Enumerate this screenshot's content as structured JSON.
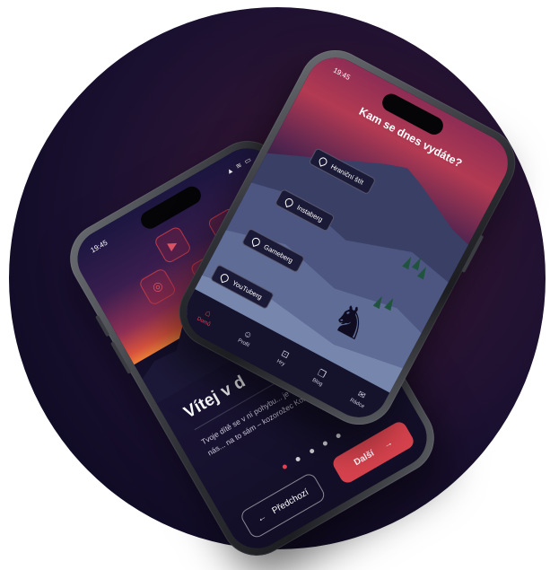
{
  "phone_left": {
    "status_time": "19:45",
    "status_icons": "▲ ≋ ▭",
    "app_icons": [
      {
        "name": "video-player-icon",
        "glyph": "▶"
      },
      {
        "name": "gamepad-icon",
        "glyph": "◆"
      },
      {
        "name": "instagram-icon",
        "glyph": "◎"
      },
      {
        "name": "youtube-icon",
        "glyph": "▶"
      }
    ],
    "title": "Vítej v d",
    "body": "Tvoje dítě se v ní pohybu... je cesta bezpečná, jindy nás... na to sám – kozorožec Koro tě pov...",
    "page_indicator": {
      "count": 5,
      "active_index": 0
    },
    "prev_label": "Předchozí",
    "next_label": "Další",
    "prev_icon": "←",
    "next_icon": "→"
  },
  "phone_right": {
    "status_time": "19:45",
    "title": "Kam se dnes vydáte?",
    "locations": [
      {
        "label": "Hraniční štít"
      },
      {
        "label": "Instaberg"
      },
      {
        "label": "Gameberg"
      },
      {
        "label": "YouTuberg"
      }
    ],
    "tabs": [
      {
        "label": "Domů",
        "icon": "⌂",
        "active": true
      },
      {
        "label": "Profil",
        "icon": "☺",
        "active": false
      },
      {
        "label": "Hry",
        "icon": "⊡",
        "active": false
      },
      {
        "label": "Blog",
        "icon": "❐",
        "active": false
      },
      {
        "label": "Rádce",
        "icon": "✉",
        "active": false
      }
    ]
  },
  "colors": {
    "accent": "#d8434e",
    "background_dark": "#140f2a"
  }
}
